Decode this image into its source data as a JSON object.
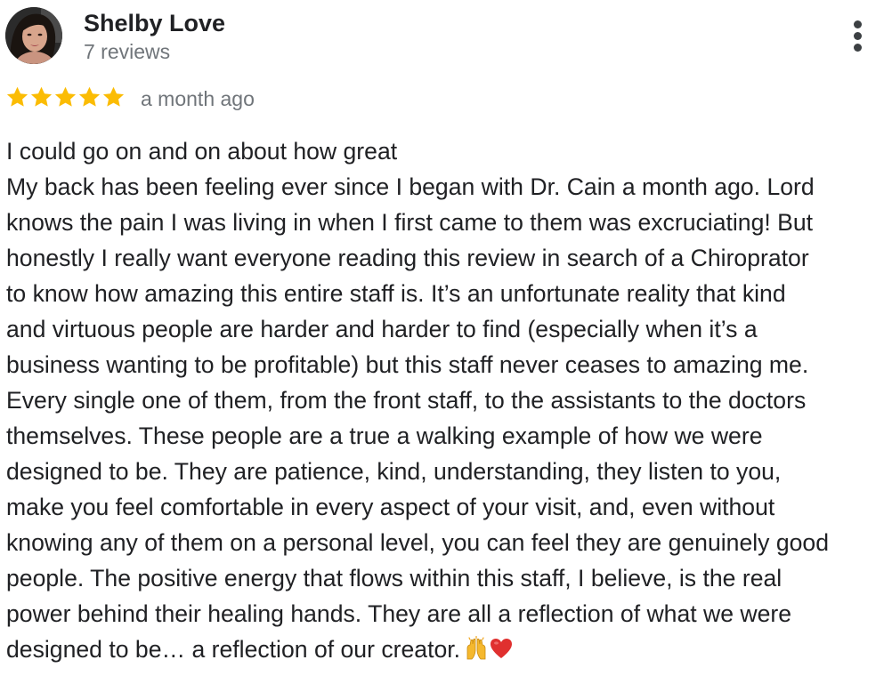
{
  "reviewer": {
    "name": "Shelby Love",
    "reviews_count": "7 reviews",
    "avatar_icon": "profile-photo"
  },
  "menu": {
    "icon": "more-vertical-icon"
  },
  "rating": {
    "stars": 5,
    "max": 5,
    "star_color": "#fbbc04",
    "date": "a month ago"
  },
  "review": {
    "lines": [
      "I could go on and on about how great",
      "My back has been feeling ever since I began with Dr. Cain a month ago. Lord",
      "knows the pain I was living in when I first came to them was excruciating! But",
      "honestly I really want everyone reading this review in search of a Chiroprator",
      "to know how amazing this entire staff is. It’s an unfortunate reality that kind",
      "and virtuous people are harder and harder to find (especially when it’s a",
      "business wanting to be profitable) but this staff never ceases to amazing me.",
      "Every single one of them, from the front staff, to the assistants to the doctors",
      "themselves. These people are a true a walking example of how we were",
      "designed to be. They are patience, kind, understanding, they listen to you,",
      "make you feel comfortable in every aspect of your visit, and, even without",
      "knowing any of them on a personal level, you can feel they are genuinely good",
      "people. The positive energy that flows within this staff, I believe, is the real",
      "power behind their healing hands. They are all a reflection of what we were",
      "designed to be… a reflection of our creator."
    ],
    "trailing_emoji": [
      "raising-hands-emoji",
      "red-heart-emoji"
    ]
  }
}
